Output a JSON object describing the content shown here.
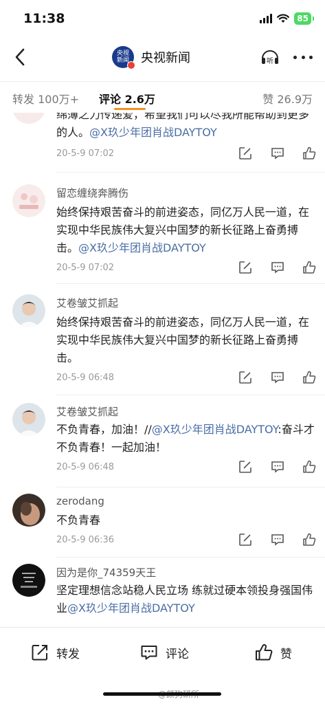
{
  "status": {
    "time": "11:38",
    "battery": "85"
  },
  "nav": {
    "logo_line1": "央视",
    "logo_line2": "新闻",
    "title": "央视新闻",
    "listen_label": "听"
  },
  "tabs": {
    "repost": "转发 100万+",
    "comment": "评论 2.6万",
    "like": "赞 26.9万"
  },
  "comments": [
    {
      "name": "",
      "text": "绵薄之力传递爱，希望我们可以尽我所能帮助到更多的人。",
      "mention": "@X玖少年团肖战DAYTOY",
      "time": "20-5-9 07:02"
    },
    {
      "name": "留恋缠绕奔腾伤",
      "text": "始终保持艰苦奋斗的前进姿态，同亿万人民一道，在实现中华民族伟大复兴中国梦的新长征路上奋勇搏击。",
      "mention": "@X玖少年团肖战DAYTOY",
      "time": "20-5-9 07:02"
    },
    {
      "name": "艾卷皱艾抓起",
      "text": "始终保持艰苦奋斗的前进姿态，同亿万人民一道，在实现中华民族伟大复兴中国梦的新长征路上奋勇搏击。",
      "mention": "",
      "time": "20-5-9 06:48"
    },
    {
      "name": "艾卷皱艾抓起",
      "text": "不负青春，加油！//",
      "mention": "@X玖少年团肖战DAYTOY",
      "text_after": ":奋斗才不负青春！一起加油！",
      "time": "20-5-9 06:48"
    },
    {
      "name": "zerodang",
      "text": "不负青春",
      "mention": "",
      "time": "20-5-9 06:36"
    },
    {
      "name": "因为是你_74359天王",
      "text": "坚定理想信念站稳人民立场 练就过硬本领投身强国伟业",
      "mention": "@X玖少年团肖战DAYTOY",
      "time": ""
    }
  ],
  "bottom": {
    "repost": "转发",
    "comment": "评论",
    "like": "赞",
    "watermark": "@颜狗研所"
  },
  "colors": {
    "accent": "#f5901e",
    "mention": "#4a6ea5",
    "battery": "#4cd964"
  },
  "icons": [
    "back-arrow-icon",
    "listen-icon",
    "more-icon",
    "edit-icon",
    "comment-icon",
    "like-icon"
  ]
}
